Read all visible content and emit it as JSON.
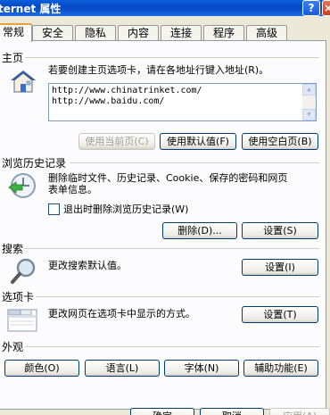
{
  "window": {
    "title": "ternet 属性",
    "help_glyph": "?",
    "close_glyph": "×"
  },
  "tabs": [
    {
      "label": "常规",
      "active": true
    },
    {
      "label": "安全"
    },
    {
      "label": "隐私"
    },
    {
      "label": "内容"
    },
    {
      "label": "连接"
    },
    {
      "label": "程序"
    },
    {
      "label": "高级"
    }
  ],
  "homepage": {
    "group_title": "主页",
    "instruction": "若要创建主页选项卡，请在各地址行键入地址(R)。",
    "urls": [
      "http://www.chinatrinket.com/",
      "http://www.baidu.com/"
    ],
    "btn_current": "使用当前页(C)",
    "btn_default": "使用默认值(F)",
    "btn_blank": "使用空白页(B)"
  },
  "history": {
    "group_title": "浏览历史记录",
    "description_line1": "删除临时文件、历史记录、Cookie、保存的密码和网页",
    "description_line2": "表单信息。",
    "checkbox_label": "退出时删除浏览历史记录(W)",
    "btn_delete": "删除(D)...",
    "btn_settings": "设置(S)"
  },
  "search": {
    "group_title": "搜索",
    "description": "更改搜索默认值。",
    "btn_settings": "设置(I)"
  },
  "tabs_section": {
    "group_title": "选项卡",
    "description": "更改网页在选项卡中显示的方式。",
    "btn_settings": "设置(T)"
  },
  "appearance": {
    "group_title": "外观",
    "btn_colors": "颜色(O)",
    "btn_languages": "语言(L)",
    "btn_fonts": "字体(N)",
    "btn_accessibility": "辅助功能(E)"
  },
  "footer": {
    "btn_ok": "确定",
    "btn_cancel": "取消",
    "btn_apply": "应用(A)"
  }
}
